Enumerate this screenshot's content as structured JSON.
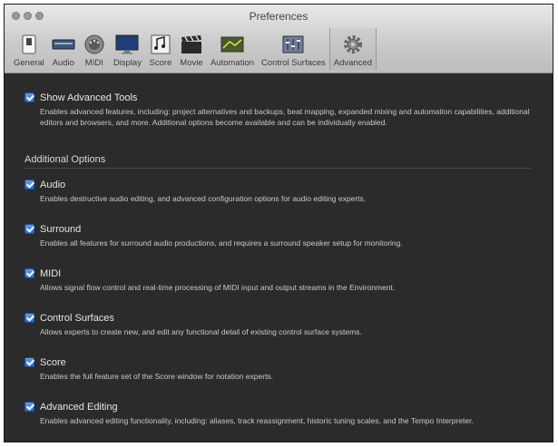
{
  "window": {
    "title": "Preferences"
  },
  "toolbar": {
    "items": [
      {
        "label": "General",
        "icon": "switch-icon"
      },
      {
        "label": "Audio",
        "icon": "audio-interface-icon"
      },
      {
        "label": "MIDI",
        "icon": "midi-connector-icon"
      },
      {
        "label": "Display",
        "icon": "display-icon"
      },
      {
        "label": "Score",
        "icon": "score-notes-icon"
      },
      {
        "label": "Movie",
        "icon": "clapperboard-icon"
      },
      {
        "label": "Automation",
        "icon": "automation-curve-icon"
      },
      {
        "label": "Control Surfaces",
        "icon": "control-surface-icon"
      },
      {
        "label": "Advanced",
        "icon": "gear-icon",
        "selected": true
      }
    ]
  },
  "advanced_tools": {
    "label": "Show Advanced Tools",
    "checked": true,
    "description": "Enables advanced features, including: project alternatives and backups, beat mapping, expanded mixing and automation capabilities, additional editors and browsers, and more. Additional options become available and can be individually enabled."
  },
  "additional_options": {
    "title": "Additional Options",
    "items": [
      {
        "label": "Audio",
        "checked": true,
        "description": "Enables destructive audio editing, and advanced configuration options for audio editing experts."
      },
      {
        "label": "Surround",
        "checked": true,
        "description": "Enables all features for surround audio productions, and requires a surround speaker setup for monitoring."
      },
      {
        "label": "MIDI",
        "checked": true,
        "description": "Allows signal flow control and real-time processing of MIDI input and output streams in the Environment."
      },
      {
        "label": "Control Surfaces",
        "checked": true,
        "description": "Allows experts to create new, and edit any functional detail of existing control surface systems."
      },
      {
        "label": "Score",
        "checked": true,
        "description": "Enables the full feature set of the Score window for notation experts."
      },
      {
        "label": "Advanced Editing",
        "checked": true,
        "description": "Enables advanced editing functionality, including: aliases, track reassignment, historic tuning scales, and the Tempo Interpreter."
      }
    ]
  }
}
